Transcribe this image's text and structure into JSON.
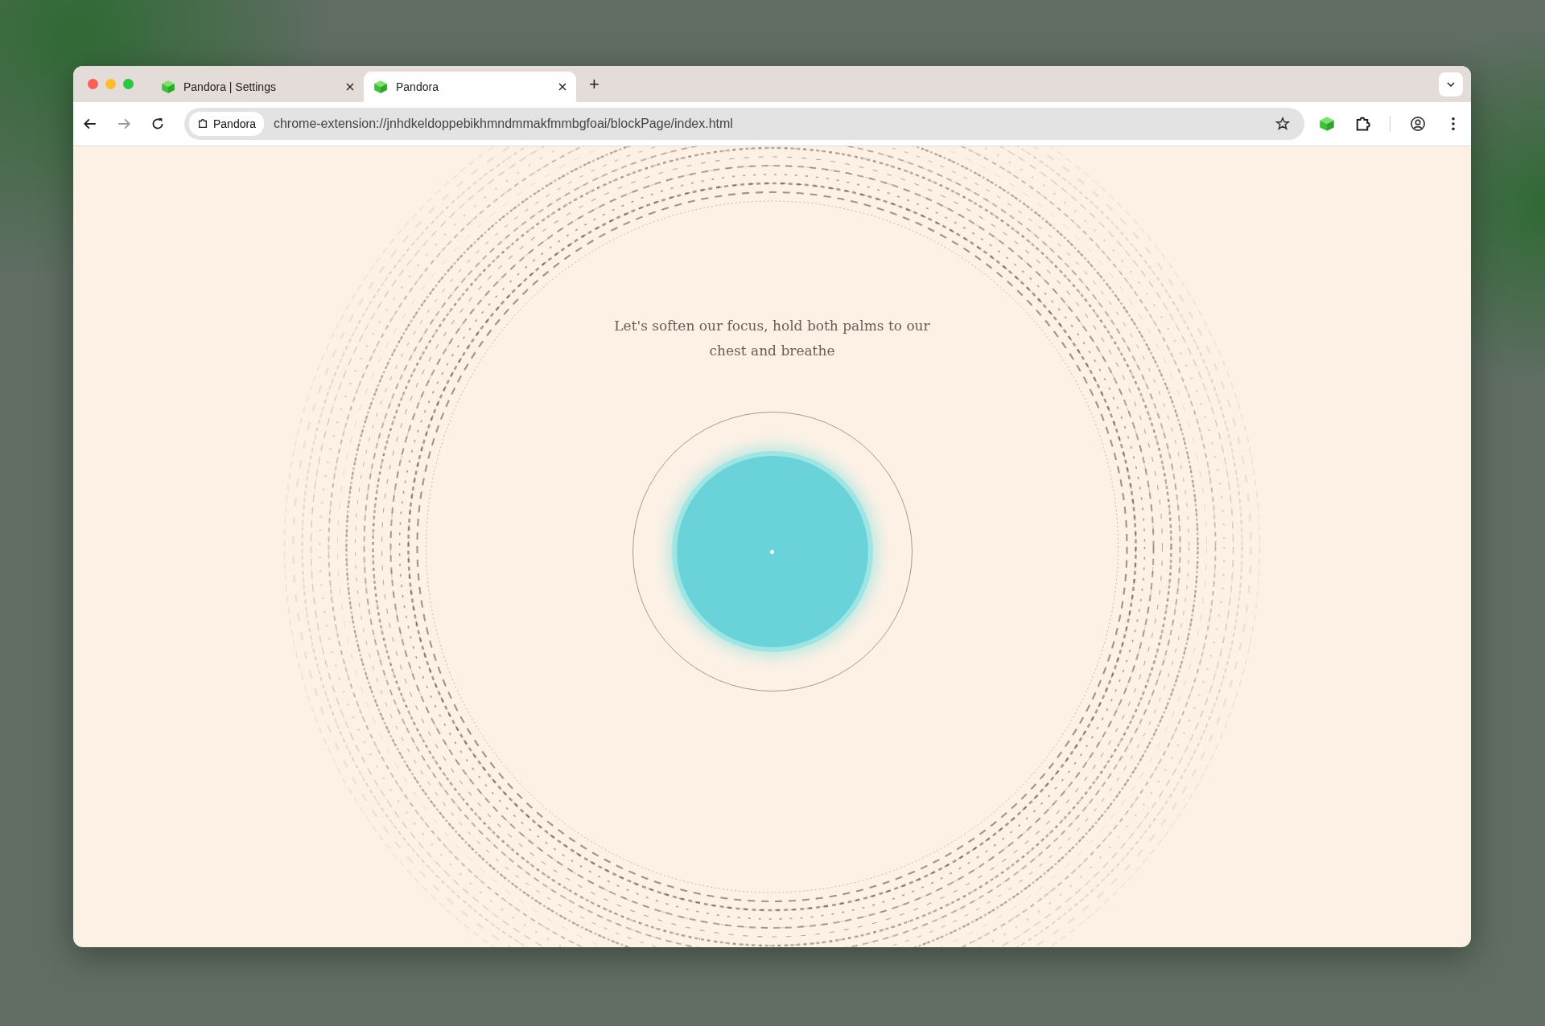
{
  "tabs": [
    {
      "label": "Pandora | Settings",
      "selected": false
    },
    {
      "label": "Pandora",
      "selected": true
    }
  ],
  "new_tab": "+",
  "address_bar": {
    "site_chip": "Pandora",
    "url": "chrome-extension://jnhdkeldoppebikhmndmmakfmmbgfoai/blockPage/index.html"
  },
  "message": "Let's soften our focus, hold both palms to our chest and breathe"
}
